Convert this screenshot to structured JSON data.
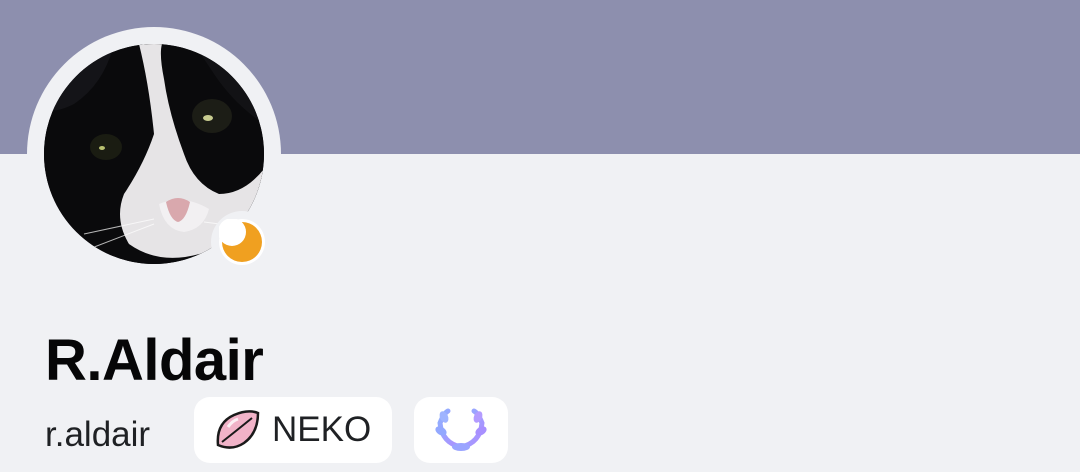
{
  "profile": {
    "banner_color": "#8d8fae",
    "display_name": "R.Aldair",
    "username": "r.aldair",
    "status": "idle",
    "status_icon": "moon-icon",
    "status_color": "#f0a020",
    "avatar_subject": "black-and-white cat"
  },
  "server_tag": {
    "icon": "pink-leaf-icon",
    "label": "NEKO"
  },
  "badges": [
    {
      "icon": "laurel-wreath-icon",
      "color": "#7e8cf0"
    }
  ]
}
